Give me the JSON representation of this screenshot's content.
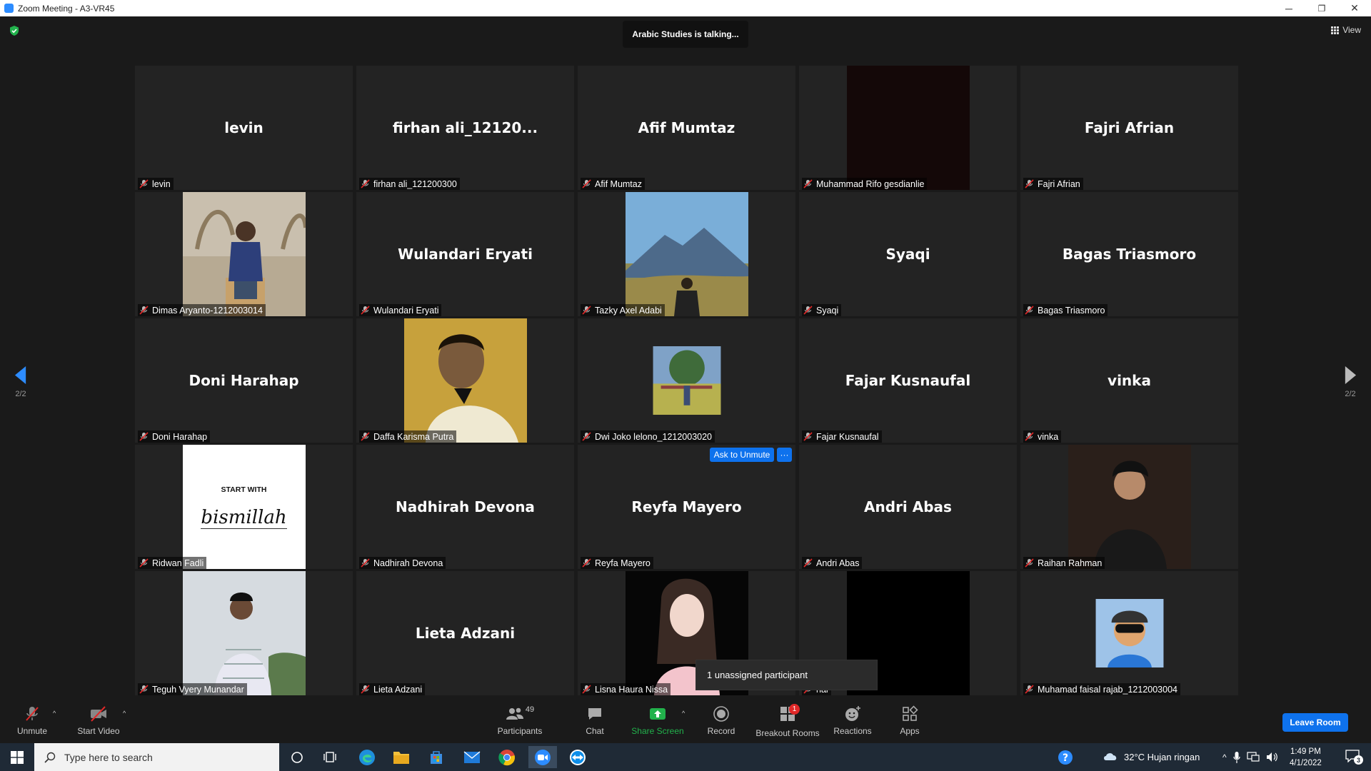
{
  "window": {
    "title": "Zoom Meeting - A3-VR45",
    "minimize": "─",
    "maximize": "❐",
    "close": "✕"
  },
  "top": {
    "talking": "Arabic Studies is talking...",
    "view_label": "View"
  },
  "pager": {
    "left": "2/2",
    "right": "2/2"
  },
  "tiles": [
    {
      "big": "levin",
      "label": "levin"
    },
    {
      "big": "firhan  ali_12120...",
      "label": "firhan ali_121200300"
    },
    {
      "big": "Afif Mumtaz",
      "label": "Afif Mumtaz"
    },
    {
      "big": "",
      "label": "Muhammad Rifo gesdianlie"
    },
    {
      "big": "Fajri Afrian",
      "label": "Fajri Afrian"
    },
    {
      "big": "",
      "label": "Dimas Aryanto-1212003014"
    },
    {
      "big": "Wulandari Eryati",
      "label": "Wulandari Eryati"
    },
    {
      "big": "",
      "label": "Tazky Axel Adabi"
    },
    {
      "big": "Syaqi",
      "label": "Syaqi"
    },
    {
      "big": "Bagas Triasmoro",
      "label": "Bagas Triasmoro"
    },
    {
      "big": "Doni Harahap",
      "label": "Doni Harahap"
    },
    {
      "big": "",
      "label": "Daffa Karisma Putra"
    },
    {
      "big": "",
      "label": "Dwi Joko lelono_1212003020"
    },
    {
      "big": "Fajar Kusnaufal",
      "label": "Fajar Kusnaufal"
    },
    {
      "big": "vinka",
      "label": "vinka"
    },
    {
      "big": "",
      "label": "Ridwan Fadli"
    },
    {
      "big": "Nadhirah Devona",
      "label": "Nadhirah Devona"
    },
    {
      "big": "Reyfa Mayero",
      "label": "Reyfa Mayero"
    },
    {
      "big": "Andri Abas",
      "label": "Andri Abas"
    },
    {
      "big": "",
      "label": "Raihan Rahman"
    },
    {
      "big": "",
      "label": "Teguh Vyery Munandar"
    },
    {
      "big": "Lieta Adzani",
      "label": "Lieta Adzani"
    },
    {
      "big": "",
      "label": "Lisna Haura Nissa"
    },
    {
      "big": "",
      "label": "nal"
    },
    {
      "big": "",
      "label": "Muhamad faisal rajab_1212003004"
    }
  ],
  "ridwan_photo": {
    "line1": "START WITH",
    "line2": "bismillah"
  },
  "ask_unmute": {
    "label": "Ask to Unmute",
    "more": "···"
  },
  "popup": {
    "unassigned": "1 unassigned participant"
  },
  "toolbar": {
    "unmute": "Unmute",
    "start_video": "Start Video",
    "participants": "Participants",
    "participants_count": "49",
    "chat": "Chat",
    "share_screen": "Share Screen",
    "record": "Record",
    "breakout_rooms": "Breakout Rooms",
    "breakout_badge": "1",
    "reactions": "Reactions",
    "apps": "Apps",
    "leave": "Leave Room"
  },
  "taskbar": {
    "search_placeholder": "Type here to search",
    "weather": "32°C  Hujan ringan",
    "time": "1:49 PM",
    "date": "4/1/2022",
    "notifications": "3"
  },
  "colors": {
    "accent": "#0e72ed",
    "mute": "#e02828",
    "share": "#22b24c"
  }
}
